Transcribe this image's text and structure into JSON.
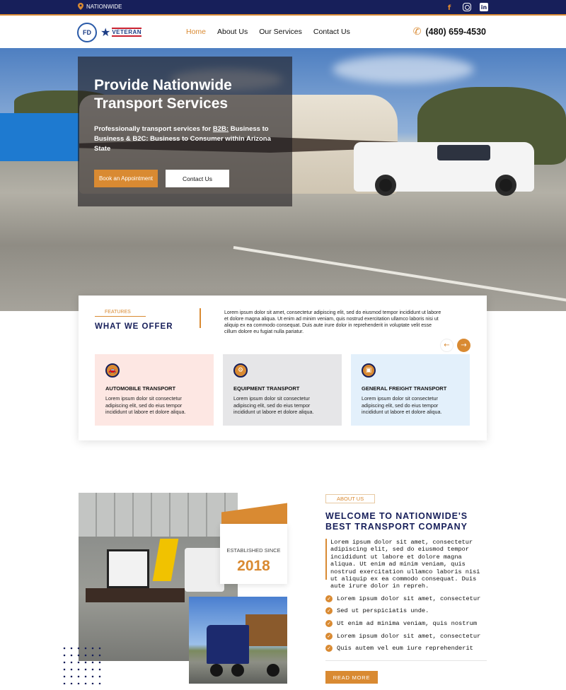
{
  "topbar": {
    "location_label": "NATIONWIDE",
    "social": [
      "facebook-icon",
      "instagram-icon",
      "linkedin-icon"
    ]
  },
  "header": {
    "logo_fd": "FD",
    "logo_veteran": "VETERAN",
    "nav": [
      {
        "label": "Home",
        "active": true
      },
      {
        "label": "About Us",
        "active": false
      },
      {
        "label": "Our Services",
        "active": false
      },
      {
        "label": "Contact Us",
        "active": false
      }
    ],
    "phone": "(480) 659-4530"
  },
  "hero": {
    "title": "Provide Nationwide Transport Services",
    "subtitle_before": "Professionally transport services for ",
    "subtitle_b2b": "B2B:",
    "subtitle_after": " Business to Business & B2C: Business to Consumer  within Arizona State",
    "book_label": "Book an Appointment",
    "contact_label": "Contact Us"
  },
  "features": {
    "tag": "FEATURES",
    "title": "WHAT WE OFFER",
    "description": "Lorem ipsum dolor sit amet, consectetur adipiscing elit, sed do eiusmod tempor incididunt ut labore et dolore magna aliqua. Ut enim ad minim veniam, quis nostrud exercitation ullamco laboris nisi ut aliquip ex ea commodo consequat. Duis aute irure dolor in reprehenderit in voluptate velit esse cillum dolore eu fugiat nulla pariatur.",
    "prev": "←",
    "next": "→",
    "services": [
      {
        "name": "AUTOMOBILE TRANSPORT",
        "icon": "car-icon",
        "text": "Lorem ipsum dolor sit consectetur adipiscing elit, sed do eius tempor incididunt ut labore et dolore  aliqua.",
        "bg": "#fde7e3"
      },
      {
        "name": "EQUIPMENT TRANSPORT",
        "icon": "tractor-icon",
        "text": "Lorem ipsum dolor sit consectetur adipiscing elit, sed do eius tempor incididunt ut labore et dolore  aliqua.",
        "bg": "#e6e6e8"
      },
      {
        "name": "GENERAL FREIGHT TRANSPORT",
        "icon": "truck-icon",
        "text": "Lorem ipsum dolor sit consectetur adipiscing elit, sed do eius tempor incididunt ut labore et dolore  aliqua.",
        "bg": "#e3f0fb"
      }
    ]
  },
  "about": {
    "established_label": "ESTABLISHED SINCE",
    "established_year": "2018",
    "tag": "ABOUT US",
    "title": "WELCOME TO NATIONWIDE'S BEST TRANSPORT COMPANY",
    "description": "Lorem ipsum dolor sit amet, consectetur adipiscing elit, sed do eiusmod tempor incididunt ut labore et dolore magna aliqua. Ut enim ad minim veniam, quis nostrud exercitation ullamco laboris nisi ut aliquip ex ea commodo consequat. Duis aute irure dolor in repreh.",
    "checks": [
      "Lorem ipsum dolor sit amet, consectetur",
      "Sed ut perspiciatis unde.",
      "Ut enim ad minima veniam, quis nostrum",
      "Lorem ipsum dolor sit amet, consectetur",
      "Quis autem vel eum iure reprehenderit"
    ],
    "read_more": "READ MORE"
  },
  "colors": {
    "navy": "#171f5a",
    "accent": "#d98a32"
  }
}
